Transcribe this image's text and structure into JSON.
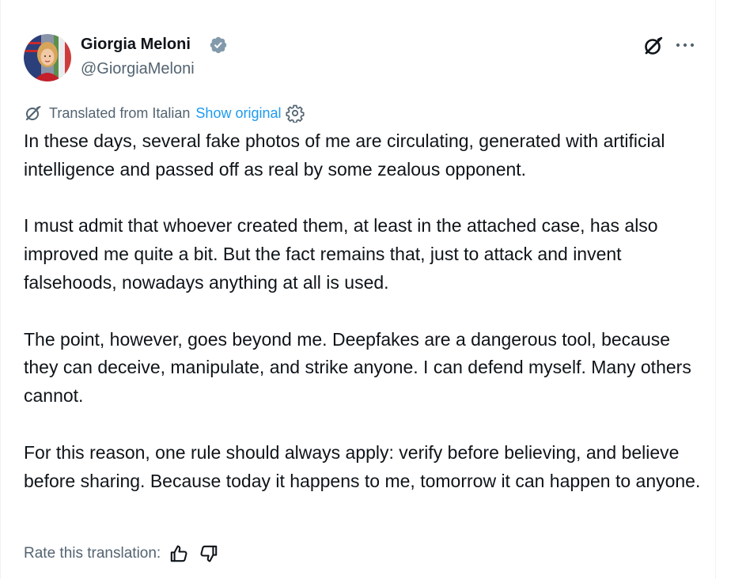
{
  "tweet": {
    "author": {
      "name": "Giorgia Meloni",
      "handle": "@GiorgiaMeloni",
      "verified": true,
      "verified_color": "#829aab"
    },
    "translation": {
      "label": "Translated from Italian",
      "show_original_label": "Show original",
      "link_color": "#1d9bf0"
    },
    "body": {
      "paragraphs": [
        "In these days, several fake photos of me are circulating, generated with artificial intelligence and passed off as real by some zealous opponent.",
        "I must admit that whoever created them, at least in the attached case, has also improved me quite a bit. But the fact remains that, just to attack and invent falsehoods, nowadays anything at all is used.",
        "The point, however, goes beyond me. Deepfakes are a dangerous tool, because they can deceive, manipulate, and strike anyone. I can defend myself. Many others cannot.",
        "For this reason, one rule should always apply: verify before believing, and believe before sharing. Because today it happens to me, tomorrow it can happen to anyone."
      ]
    },
    "rating": {
      "label": "Rate this translation:"
    },
    "icons": {
      "grok": "grok-icon",
      "more": "more-icon",
      "translate": "translate-icon",
      "settings": "gear-icon",
      "thumbs_up": "thumbs-up-icon",
      "thumbs_down": "thumbs-down-icon"
    }
  }
}
